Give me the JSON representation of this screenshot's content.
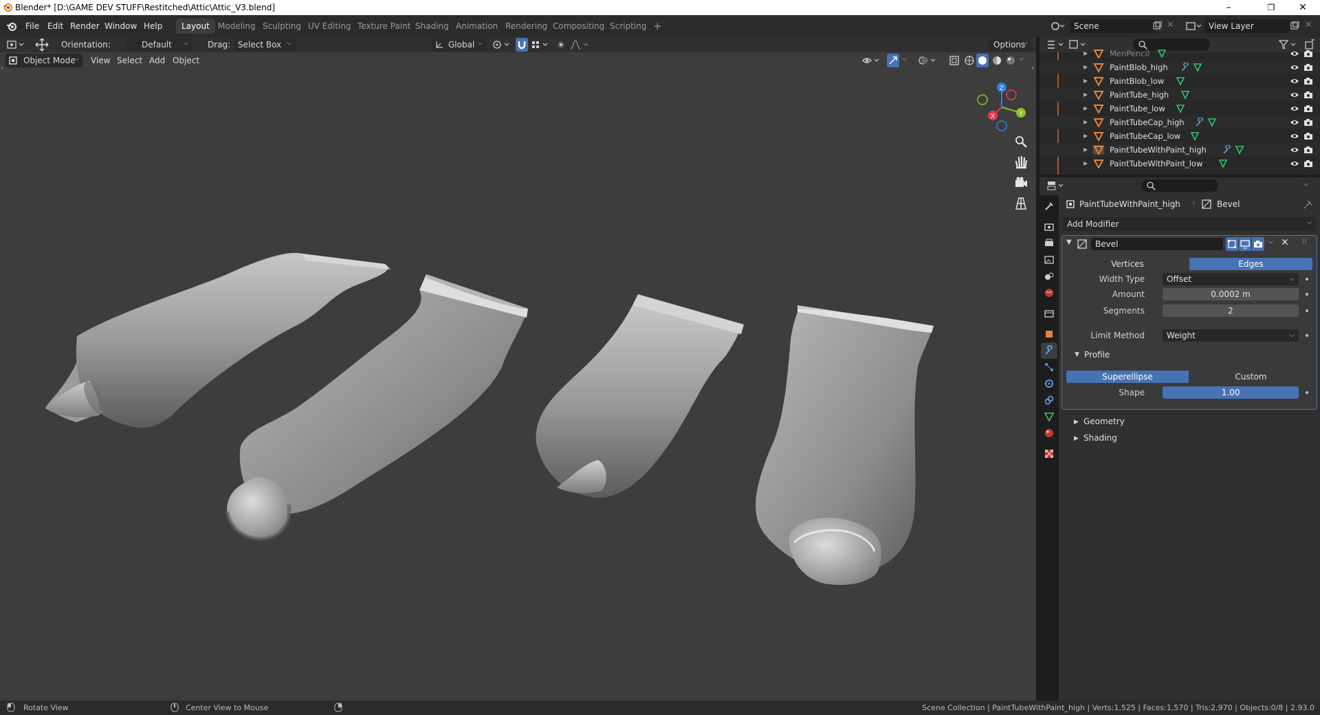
{
  "window": {
    "title": "Blender* [D:\\GAME DEV STUFF\\Restitched\\Attic\\Attic_V3.blend]",
    "minimize": "–",
    "maximize": "❐",
    "close": "✕"
  },
  "menubar": {
    "items": [
      "File",
      "Edit",
      "Render",
      "Window",
      "Help"
    ]
  },
  "workspaces": {
    "tabs": [
      "Layout",
      "Modeling",
      "Sculpting",
      "UV Editing",
      "Texture Paint",
      "Shading",
      "Animation",
      "Rendering",
      "Compositing",
      "Scripting"
    ],
    "active": "Layout",
    "add": "+"
  },
  "scene": {
    "scene_name": "Scene",
    "view_layer": "View Layer"
  },
  "tool_header": {
    "orientation_label": "Orientation:",
    "orientation_value": "Default",
    "drag_label": "Drag:",
    "drag_value": "Select Box",
    "transform_orientation": "Global",
    "options": "Options"
  },
  "viewport_header": {
    "mode": "Object Mode",
    "menus": [
      "View",
      "Select",
      "Add",
      "Object"
    ]
  },
  "gizmo": {
    "x": "X",
    "y": "Y",
    "z": "Z"
  },
  "outliner": {
    "rows": [
      {
        "name": "MenPencil",
        "mod": false,
        "dim": true
      },
      {
        "name": "PaintBlob_high",
        "mod": true,
        "dim": false
      },
      {
        "name": "PaintBlob_low",
        "mod": false,
        "dim": false
      },
      {
        "name": "PaintTube_high",
        "mod": false,
        "dim": false
      },
      {
        "name": "PaintTube_low",
        "mod": false,
        "dim": false
      },
      {
        "name": "PaintTubeCap_high",
        "mod": true,
        "dim": false
      },
      {
        "name": "PaintTubeCap_low",
        "mod": false,
        "dim": false
      },
      {
        "name": "PaintTubeWithPaint_high",
        "mod": true,
        "dim": false
      },
      {
        "name": "PaintTubeWithPaint_low",
        "mod": false,
        "dim": false
      }
    ]
  },
  "properties": {
    "object_name": "PaintTubeWithPaint_high",
    "modifier_context": "Bevel",
    "add_modifier": "Add Modifier",
    "modifier": {
      "name": "Bevel",
      "affect_options": [
        "Vertices",
        "Edges"
      ],
      "affect_active": "Edges",
      "width_type_label": "Width Type",
      "width_type_value": "Offset",
      "amount_label": "Amount",
      "amount_value": "0.0002 m",
      "segments_label": "Segments",
      "segments_value": "2",
      "limit_method_label": "Limit Method",
      "limit_method_value": "Weight",
      "profile_section": "Profile",
      "profile_options": [
        "Superellipse",
        "Custom"
      ],
      "profile_active": "Superellipse",
      "shape_label": "Shape",
      "shape_value": "1.00",
      "geometry_section": "Geometry",
      "shading_section": "Shading"
    }
  },
  "statusbar": {
    "left_action": "Rotate View",
    "middle_action": "Center View to Mouse",
    "stats": "Scene Collection | PaintTubeWithPaint_high | Verts:1,525 | Faces:1,570 | Tris:2,970 | Objects:0/8 | 2.93.0"
  },
  "colors": {
    "accent_blue": "#4772b3",
    "viewport_bg": "#3d3d3d",
    "mesh_orange": "#e4833a",
    "axis_x": "#e33a4f",
    "axis_y": "#8dbf25",
    "axis_z": "#2e7fe0"
  }
}
